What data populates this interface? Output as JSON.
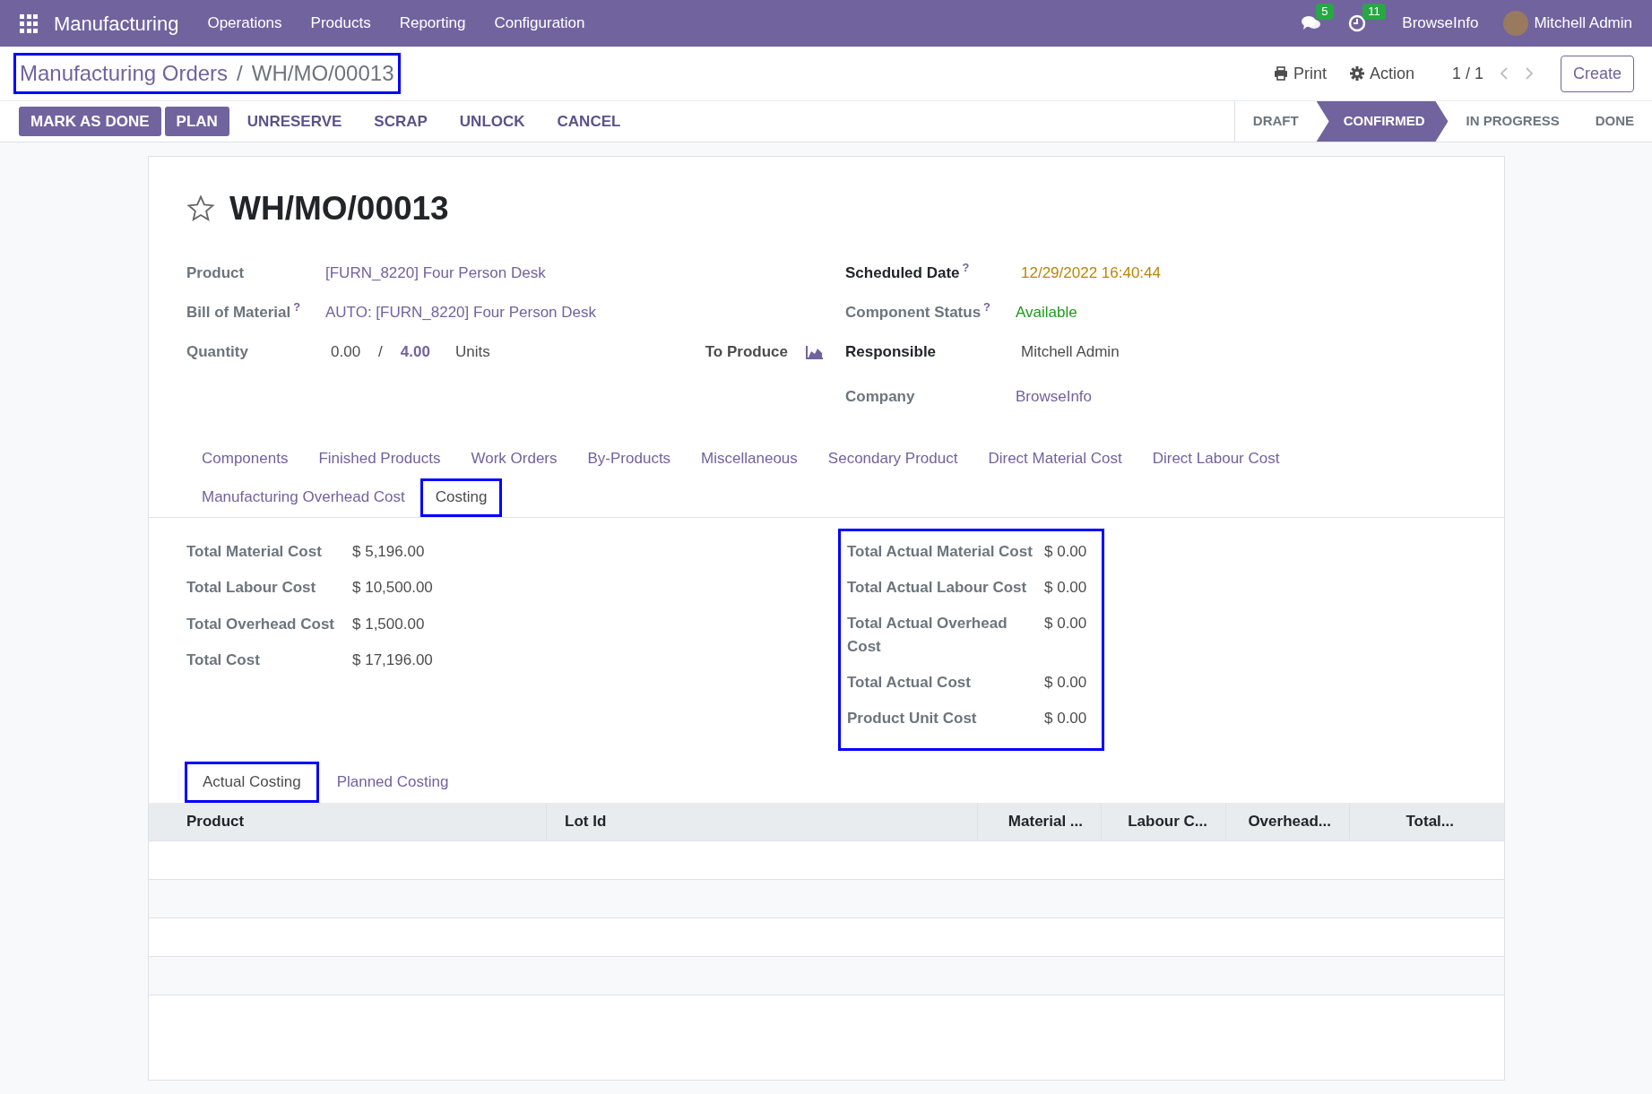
{
  "navbar": {
    "app": "Manufacturing",
    "menus": [
      "Operations",
      "Products",
      "Reporting",
      "Configuration"
    ],
    "messages_count": "5",
    "activities_count": "11",
    "company": "BrowseInfo",
    "user": "Mitchell Admin"
  },
  "breadcrumb": {
    "parent": "Manufacturing Orders",
    "separator": "/",
    "current": "WH/MO/00013",
    "highlighted": true
  },
  "control": {
    "print": "Print",
    "action": "Action",
    "pager": "1 / 1",
    "create": "Create"
  },
  "buttons": [
    {
      "label": "MARK AS DONE",
      "primary": true
    },
    {
      "label": "PLAN",
      "primary": true
    },
    {
      "label": "UNRESERVE",
      "primary": false
    },
    {
      "label": "SCRAP",
      "primary": false
    },
    {
      "label": "UNLOCK",
      "primary": false
    },
    {
      "label": "CANCEL",
      "primary": false
    }
  ],
  "statuses": [
    {
      "label": "DRAFT",
      "selected": false
    },
    {
      "label": "CONFIRMED",
      "selected": true
    },
    {
      "label": "IN PROGRESS",
      "selected": false
    },
    {
      "label": "DONE",
      "selected": false
    }
  ],
  "record": {
    "title": "WH/MO/00013",
    "starred": false,
    "product_label": "Product",
    "product": "[FURN_8220] Four Person Desk",
    "bom_label": "Bill of Material",
    "bom_help": "?",
    "bom": "AUTO: [FURN_8220] Four Person Desk",
    "quantity_label": "Quantity",
    "qty_done": "0.00",
    "qty_sep": "/",
    "qty_total": "4.00",
    "uom": "Units",
    "to_produce": "To Produce",
    "scheduled_label": "Scheduled Date",
    "scheduled_help": "?",
    "scheduled": "12/29/2022 16:40:44",
    "component_label": "Component Status",
    "component_help": "?",
    "component": "Available",
    "responsible_label": "Responsible",
    "responsible": "Mitchell Admin",
    "company_label": "Company",
    "company": "BrowseInfo"
  },
  "tabs": [
    {
      "label": "Components",
      "selected": false,
      "highlighted": false
    },
    {
      "label": "Finished Products",
      "selected": false,
      "highlighted": false
    },
    {
      "label": "Work Orders",
      "selected": false,
      "highlighted": false
    },
    {
      "label": "By-Products",
      "selected": false,
      "highlighted": false
    },
    {
      "label": "Miscellaneous",
      "selected": false,
      "highlighted": false
    },
    {
      "label": "Secondary Product",
      "selected": false,
      "highlighted": false
    },
    {
      "label": "Direct Material Cost",
      "selected": false,
      "highlighted": false
    },
    {
      "label": "Direct Labour Cost",
      "selected": false,
      "highlighted": false
    },
    {
      "label": "Manufacturing Overhead Cost",
      "selected": false,
      "highlighted": false
    },
    {
      "label": "Costing",
      "selected": true,
      "highlighted": true
    }
  ],
  "planned_costs": [
    {
      "label": "Total Material Cost",
      "value": "$ 5,196.00"
    },
    {
      "label": "Total Labour Cost",
      "value": "$ 10,500.00"
    },
    {
      "label": "Total Overhead Cost",
      "value": "$ 1,500.00"
    },
    {
      "label": "Total Cost",
      "value": "$ 17,196.00"
    }
  ],
  "actual_costs": {
    "highlighted": true,
    "rows": [
      {
        "label": "Total Actual Material Cost",
        "value": "$ 0.00"
      },
      {
        "label": "Total Actual Labour Cost",
        "value": "$ 0.00"
      },
      {
        "label": "Total Actual Overhead Cost",
        "value": "$ 0.00"
      },
      {
        "label": "Total Actual Cost",
        "value": "$ 0.00"
      },
      {
        "label": "Product Unit Cost",
        "value": "$ 0.00"
      }
    ]
  },
  "sub_tabs": [
    {
      "label": "Actual Costing",
      "selected": true,
      "highlighted": true
    },
    {
      "label": "Planned Costing",
      "selected": false,
      "highlighted": false
    }
  ],
  "table": {
    "columns": [
      "Product",
      "Lot Id",
      "Material ...",
      "Labour C...",
      "Overhead...",
      "Total..."
    ]
  }
}
